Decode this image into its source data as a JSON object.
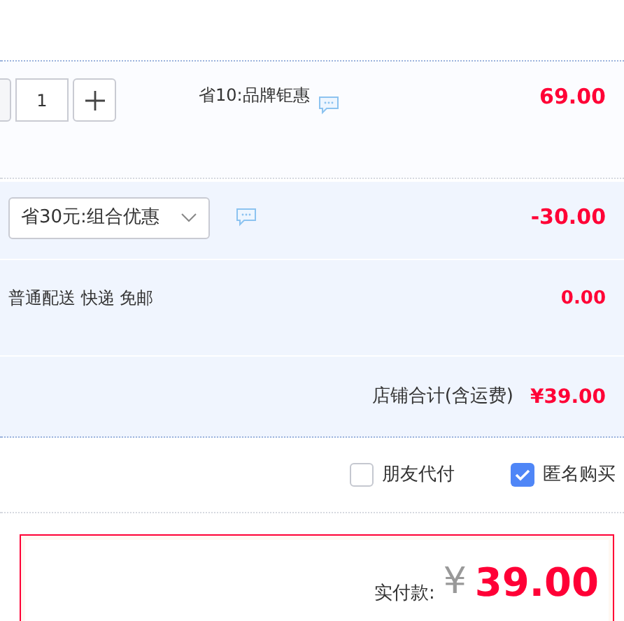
{
  "item": {
    "quantity": "1",
    "promotion": "省10:品牌钜惠",
    "price": "69.00"
  },
  "combo_discount": {
    "selector": "省30元:组合优惠",
    "amount": "-30.00"
  },
  "shipping": {
    "label": "普通配送 快递 免邮",
    "amount": "0.00"
  },
  "store_total": {
    "label": "店铺合计(含运费)",
    "amount": "¥39.00"
  },
  "options": [
    {
      "label": "朋友代付",
      "checked": false
    },
    {
      "label": "匿名购买",
      "checked": true
    }
  ],
  "payment": {
    "label": "实付款:",
    "currency": "¥",
    "amount": "39.00"
  }
}
